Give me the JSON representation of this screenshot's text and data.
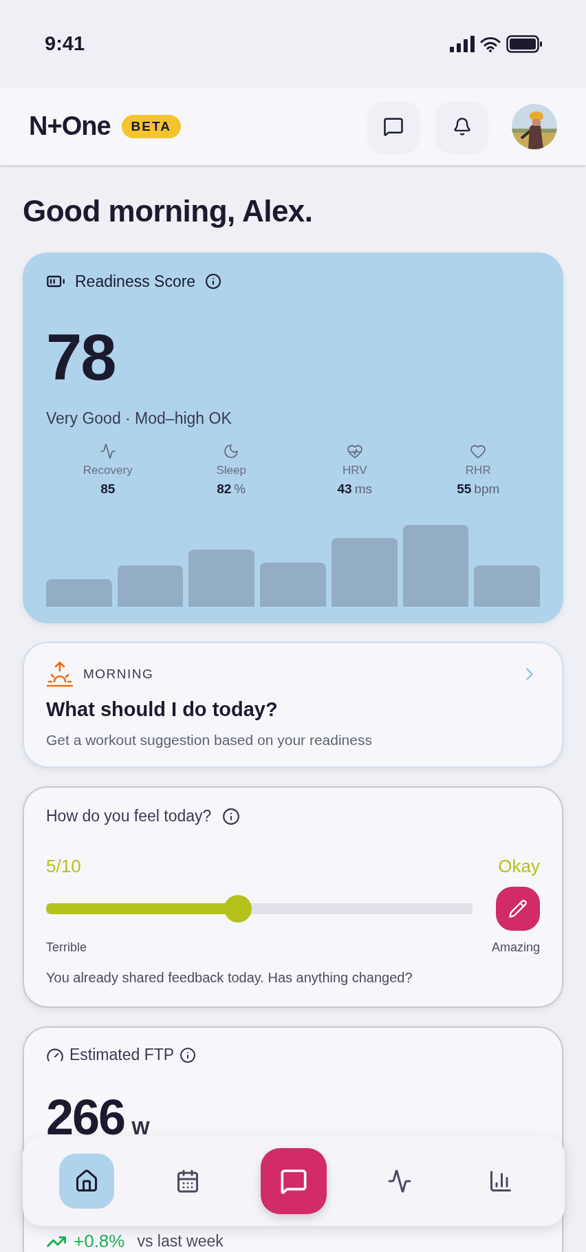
{
  "status_bar": {
    "time": "9:41"
  },
  "header": {
    "logo": "N+One",
    "badge": "BETA"
  },
  "greeting": "Good morning, Alex.",
  "readiness": {
    "title": "Readiness Score",
    "score": "78",
    "summary": "Very Good · Mod–high OK",
    "metrics": [
      {
        "label": "Recovery",
        "value": "85"
      },
      {
        "label": "Sleep",
        "value": "82",
        "unit": "%"
      },
      {
        "label": "HRV",
        "value": "43",
        "unit": "ms"
      },
      {
        "label": "RHR",
        "value": "55",
        "unit": "bpm"
      }
    ]
  },
  "morning": {
    "eyebrow": "MORNING",
    "title": "What should I do today?",
    "subtitle": "Get a workout suggestion based on your readiness"
  },
  "feel": {
    "title": "How do you feel today?",
    "score": "5/10",
    "mood": "Okay",
    "level": 0.45,
    "min_label": "Terrible",
    "max_label": "Amazing",
    "note": "You already shared feedback today. Has anything changed?"
  },
  "ftp": {
    "title": "Estimated FTP",
    "value": "266",
    "unit": "W",
    "change": "+0.8%",
    "change_note": "vs last week"
  },
  "nav": [
    {
      "kind": "tab",
      "selected": true
    },
    {
      "kind": "tab",
      "selected": false
    },
    {
      "kind": "action"
    },
    {
      "kind": "tab",
      "selected": false
    },
    {
      "kind": "tab",
      "selected": false
    }
  ]
}
